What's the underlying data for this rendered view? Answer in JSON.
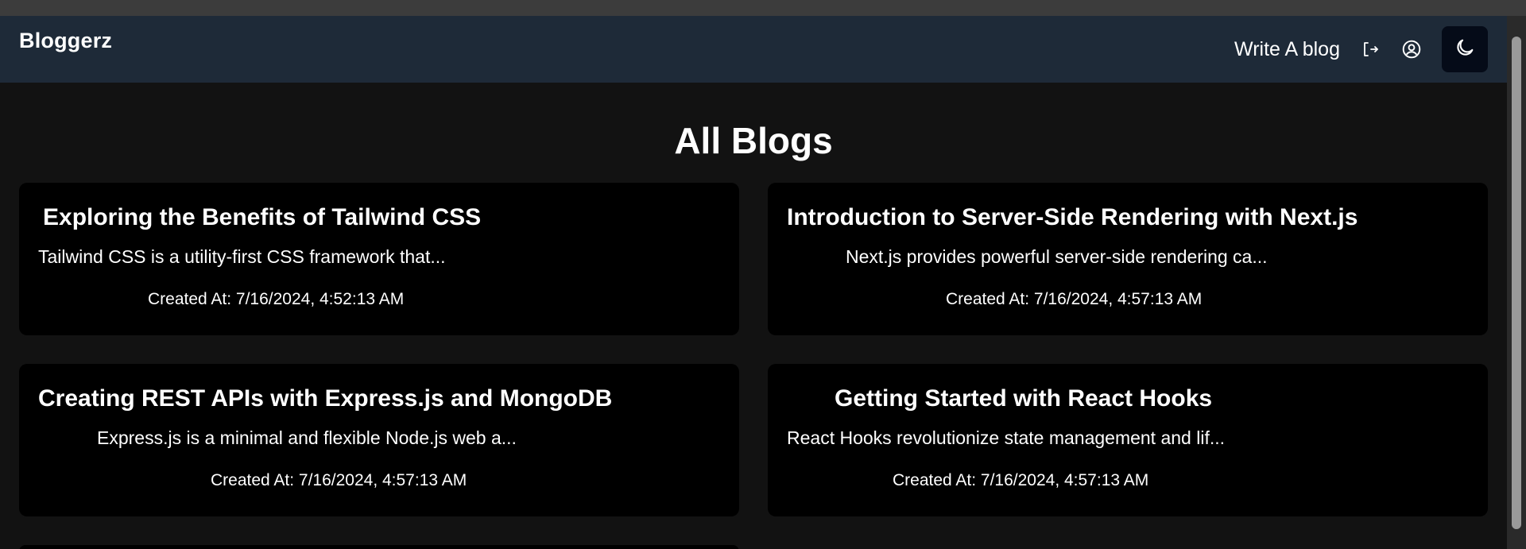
{
  "app": {
    "brand": "Bloggerz"
  },
  "nav": {
    "write_label": "Write A blog",
    "logout_icon": "logout-icon",
    "profile_icon": "user-circle-icon",
    "theme_icon": "moon-icon"
  },
  "main": {
    "title": "All Blogs"
  },
  "blogs": [
    {
      "title": "Exploring the Benefits of Tailwind CSS",
      "excerpt": "Tailwind CSS is a utility-first CSS framework that...",
      "created": "Created At: 7/16/2024, 4:52:13 AM"
    },
    {
      "title": "Introduction to Server-Side Rendering with Next.js",
      "excerpt": "Next.js provides powerful server-side rendering ca...",
      "created": "Created At: 7/16/2024, 4:57:13 AM"
    },
    {
      "title": "Creating REST APIs with Express.js and MongoDB",
      "excerpt": "Express.js is a minimal and flexible Node.js web a...",
      "created": "Created At: 7/16/2024, 4:57:13 AM"
    },
    {
      "title": "Getting Started with React Hooks",
      "excerpt": "React Hooks revolutionize state management and lif...",
      "created": "Created At: 7/16/2024, 4:57:13 AM"
    }
  ],
  "colors": {
    "page_bg": "#121212",
    "navbar_bg": "#1e2a38",
    "card_bg": "#000000",
    "theme_button_bg": "#050b18"
  }
}
